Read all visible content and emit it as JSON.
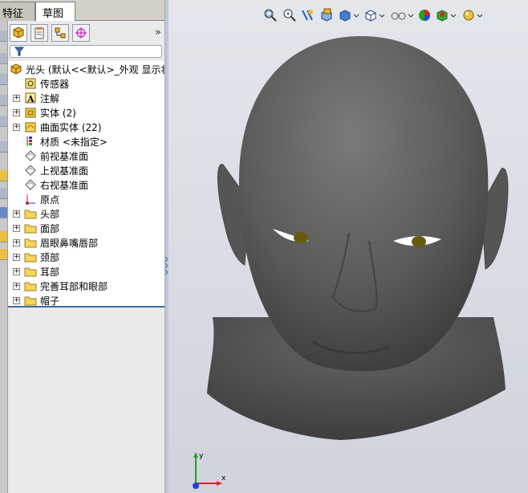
{
  "tabs": [
    {
      "label": "特征"
    },
    {
      "label": "草图"
    }
  ],
  "panel": {
    "expand_label": "»",
    "root_label": "光头   (默认<<默认>_外观 显示状",
    "items": [
      {
        "label": "传感器",
        "icon": "sensor-icon",
        "expandable": false
      },
      {
        "label": "注解",
        "icon": "annotation-icon",
        "expandable": true
      },
      {
        "label": "实体 (2)",
        "icon": "solid-body-icon",
        "expandable": true
      },
      {
        "label": "曲面实体 (22)",
        "icon": "surface-body-icon",
        "expandable": true
      },
      {
        "label": "材质 <未指定>",
        "icon": "material-icon",
        "expandable": false
      },
      {
        "label": "前视基准面",
        "icon": "plane-icon",
        "expandable": false
      },
      {
        "label": "上视基准面",
        "icon": "plane-icon",
        "expandable": false
      },
      {
        "label": "右视基准面",
        "icon": "plane-icon",
        "expandable": false
      },
      {
        "label": "原点",
        "icon": "origin-icon",
        "expandable": false
      },
      {
        "label": "头部",
        "icon": "folder-icon",
        "expandable": true
      },
      {
        "label": "面部",
        "icon": "folder-icon",
        "expandable": true
      },
      {
        "label": "眉眼鼻嘴唇部",
        "icon": "folder-icon",
        "expandable": true
      },
      {
        "label": "颈部",
        "icon": "folder-icon",
        "expandable": true
      },
      {
        "label": "耳部",
        "icon": "folder-icon",
        "expandable": true
      },
      {
        "label": "完善耳部和眼部",
        "icon": "folder-icon",
        "expandable": true
      },
      {
        "label": "帽子",
        "icon": "folder-icon",
        "expandable": true
      }
    ]
  },
  "triad": {
    "x": "x",
    "y": "y"
  },
  "colors": {
    "folder": "#f5d55a",
    "accent": "#3a6ea5",
    "model": "#5a5a5a"
  }
}
